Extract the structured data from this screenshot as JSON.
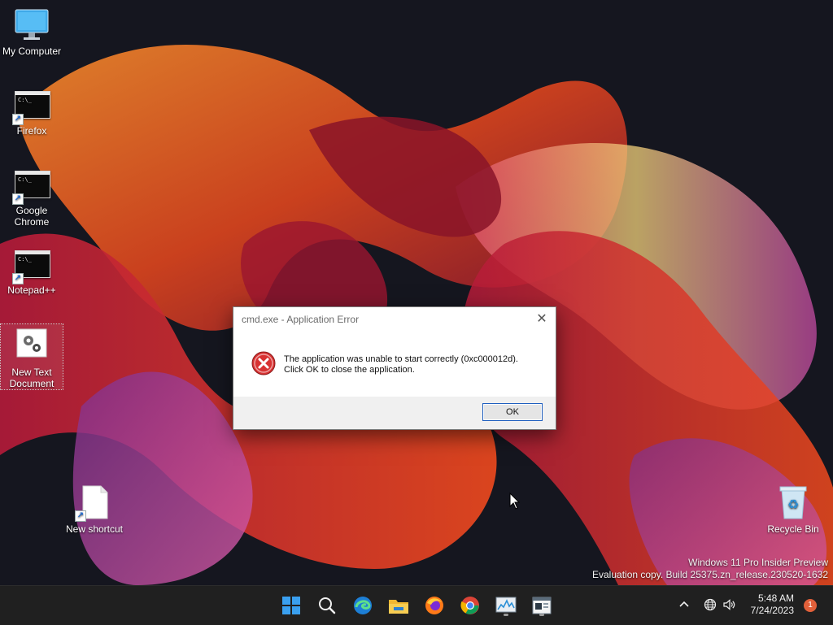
{
  "desktop": {
    "icons": [
      {
        "label": "My Computer"
      },
      {
        "label": "Firefox",
        "glyph": "C:\\_"
      },
      {
        "label": "Google Chrome",
        "glyph": "C:\\_"
      },
      {
        "label": "Notepad++",
        "glyph": "C:\\_"
      },
      {
        "label": "New Text Document"
      },
      {
        "label": "New shortcut"
      },
      {
        "label": "Recycle Bin"
      }
    ],
    "watermark": {
      "line1": "Windows 11 Pro Insider Preview",
      "line2": "Evaluation copy. Build 25375.zn_release.230520-1632"
    }
  },
  "dialog": {
    "title": "cmd.exe - Application Error",
    "close_glyph": "✕",
    "message_line1": "The application was unable to start correctly (0xc000012d).",
    "message_line2": "Click OK to close the application.",
    "ok_label": "OK"
  },
  "taskbar": {
    "apps": [
      "start-icon",
      "search-icon",
      "edge-icon",
      "file-explorer-icon",
      "firefox-icon",
      "chrome-icon",
      "task-manager-icon",
      "notepad-icon"
    ],
    "tray": {
      "chevron": "^",
      "time": "5:48 AM",
      "date": "7/24/2023",
      "notification_count": "1"
    }
  },
  "colors": {
    "wallpaper_bg": "#15161f",
    "accent": "#1f5fbf",
    "error_red": "#d32f2f",
    "taskbar": "#202020"
  }
}
